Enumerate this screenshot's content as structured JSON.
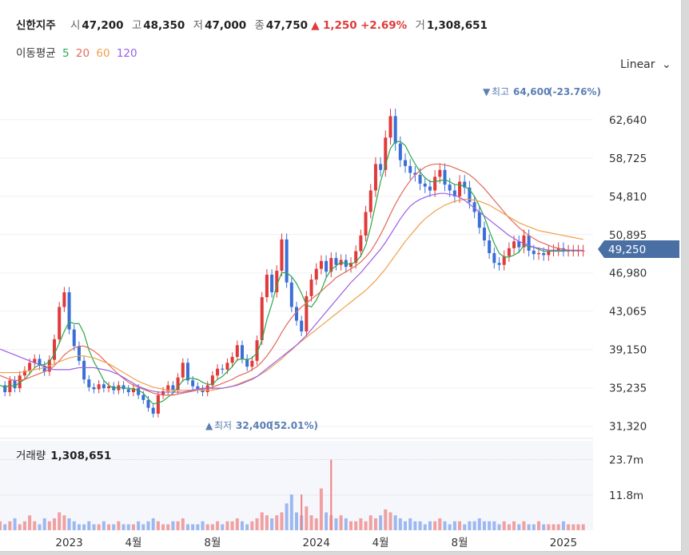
{
  "header": {
    "name": "신한지주",
    "open_label": "시",
    "open": "47,200",
    "high_label": "고",
    "high": "48,350",
    "low_label": "저",
    "low": "47,000",
    "close_label": "종",
    "close": "47,750",
    "change": "1,250",
    "change_pct": "+2.69%",
    "volume_label": "거",
    "volume": "1,308,651"
  },
  "moving_average": {
    "label": "이동평균",
    "periods": [
      {
        "value": "5",
        "color": "#2aa84a"
      },
      {
        "value": "20",
        "color": "#e26a5a"
      },
      {
        "value": "60",
        "color": "#f0a04b"
      },
      {
        "value": "120",
        "color": "#9b5de5"
      }
    ]
  },
  "scale_button": {
    "label": "Linear"
  },
  "current_price": "49,250",
  "volume_panel": {
    "label": "거래량",
    "value": "1,308,651"
  },
  "annotations": {
    "high": {
      "label": "최고",
      "value": "64,600",
      "pct": "(-23.76%)"
    },
    "low": {
      "label": "최저",
      "value": "32,400",
      "pct": "(52.01%)"
    }
  },
  "colors": {
    "up": "#e03a3a",
    "down": "#3a6fd8",
    "price_tag": "#4a6fa5"
  },
  "chart_data": {
    "type": "line",
    "price_axis": {
      "ticks": [
        "62,640",
        "58,725",
        "54,810",
        "50,895",
        "46,980",
        "43,065",
        "39,150",
        "35,235",
        "31,320"
      ],
      "ylim": [
        30400,
        66700
      ]
    },
    "volume_axis": {
      "ticks": [
        "23.7m",
        "11.8m"
      ],
      "ylim": [
        0,
        30
      ]
    },
    "x_ticks": [
      "2023",
      "4월",
      "8월",
      "2024",
      "4월",
      "8월",
      "2025"
    ],
    "x_tick_positions": [
      12,
      25,
      41,
      62,
      75,
      91,
      112
    ],
    "x_range": [
      -2,
      118
    ],
    "series": [
      {
        "name": "price",
        "x": [
          -2,
          -1,
          0,
          1,
          2,
          3,
          4,
          5,
          6,
          7,
          8,
          9,
          10,
          11,
          12,
          13,
          14,
          15,
          16,
          17,
          18,
          19,
          20,
          21,
          22,
          23,
          24,
          25,
          26,
          27,
          28,
          29,
          30,
          31,
          32,
          33,
          34,
          35,
          36,
          37,
          38,
          39,
          40,
          41,
          42,
          43,
          44,
          45,
          46,
          47,
          48,
          49,
          50,
          51,
          52,
          53,
          54,
          55,
          56,
          57,
          58,
          59,
          60,
          61,
          62,
          63,
          64,
          65,
          66,
          67,
          68,
          69,
          70,
          71,
          72,
          73,
          74,
          75,
          76,
          77,
          78,
          79,
          80,
          81,
          82,
          83,
          84,
          85,
          86,
          87,
          88,
          89,
          90,
          91,
          92,
          93,
          94,
          95,
          96,
          97,
          98,
          99,
          100,
          101,
          102,
          103,
          104,
          105,
          106,
          107,
          108,
          109,
          110,
          111,
          112,
          113,
          114,
          115,
          116
        ],
        "values": [
          35500,
          34800,
          36000,
          35200,
          36500,
          37000,
          37800,
          38200,
          37500,
          36900,
          38100,
          40200,
          43500,
          45000,
          41200,
          39500,
          38000,
          36100,
          35300,
          35100,
          35600,
          35200,
          35400,
          35000,
          35500,
          35100,
          34800,
          35200,
          34500,
          34000,
          33200,
          32600,
          34500,
          34900,
          35500,
          35000,
          36300,
          37800,
          36000,
          35400,
          35100,
          34800,
          35500,
          36500,
          37200,
          37100,
          37800,
          38400,
          39600,
          38200,
          37400,
          38000,
          40100,
          44500,
          46800,
          45000,
          47200,
          50400,
          46000,
          43500,
          42100,
          41000,
          44600,
          46300,
          47400,
          48200,
          47100,
          48500,
          47800,
          48300,
          47600,
          48000,
          49200,
          50800,
          53200,
          55400,
          58100,
          57500,
          60800,
          63000,
          60200,
          58500,
          57900,
          57200,
          57000,
          56100,
          55800,
          55400,
          56800,
          57500,
          56000,
          55400,
          54800,
          56300,
          55700,
          54200,
          53200,
          51600,
          50300,
          49000,
          48000,
          47800,
          48700,
          49500,
          50200,
          49600,
          50800,
          49250,
          48900,
          49000,
          48800,
          49250,
          49300,
          49500,
          49250,
          49250,
          49250,
          49250,
          49250
        ],
        "color": "#3a6fd8"
      },
      {
        "name": "5",
        "values": [
          35500,
          35300,
          35500,
          35400,
          35800,
          36100,
          36700,
          37300,
          37600,
          37600,
          37900,
          38700,
          39800,
          41000,
          42000,
          41800,
          41800,
          40800,
          39100,
          37900,
          37000,
          36000,
          35500,
          35200,
          35300,
          35200,
          35200,
          35100,
          35000,
          34700,
          34100,
          33600,
          33700,
          33900,
          34300,
          34700,
          35300,
          36000,
          36200,
          36200,
          36100,
          35800,
          35600,
          35600,
          36100,
          36400,
          36900,
          37400,
          38100,
          38200,
          38100,
          38300,
          38800,
          40100,
          42200,
          43800,
          45700,
          47000,
          47000,
          46600,
          45900,
          44900,
          43700,
          43500,
          44200,
          45200,
          46500,
          47300,
          47700,
          48100,
          47900,
          47900,
          48100,
          48700,
          49800,
          51700,
          54000,
          56300,
          58000,
          59700,
          60400,
          60400,
          60000,
          59000,
          58100,
          57300,
          56700,
          56300,
          56300,
          56400,
          56500,
          56300,
          56000,
          56000,
          55800,
          55500,
          54800,
          53800,
          52700,
          51300,
          50000,
          49000,
          48600,
          48600,
          48800,
          49100,
          49800,
          49700,
          49600,
          49400,
          49200,
          49200,
          49200,
          49200,
          49200,
          49250,
          49250,
          49250,
          49250
        ],
        "color": "#2aa84a"
      },
      {
        "name": "20",
        "values": [
          36500,
          36300,
          36100,
          36000,
          36000,
          36100,
          36300,
          36500,
          36700,
          36900,
          37100,
          37500,
          38000,
          38600,
          39000,
          39300,
          39500,
          39500,
          39300,
          39000,
          38600,
          38100,
          37600,
          37100,
          36600,
          36200,
          35800,
          35500,
          35300,
          35100,
          34900,
          34700,
          34600,
          34500,
          34500,
          34500,
          34600,
          34700,
          34800,
          34900,
          35000,
          35100,
          35200,
          35300,
          35500,
          35700,
          35900,
          36100,
          36400,
          36600,
          36800,
          37100,
          37400,
          37900,
          38500,
          39200,
          40000,
          40900,
          41700,
          42400,
          43000,
          43500,
          43900,
          44300,
          44700,
          45100,
          45600,
          46000,
          46500,
          46800,
          47100,
          47400,
          47700,
          48100,
          48600,
          49200,
          50000,
          50900,
          51900,
          53000,
          54000,
          54900,
          55700,
          56400,
          57000,
          57400,
          57800,
          58000,
          58100,
          58100,
          58000,
          57900,
          57700,
          57500,
          57300,
          57000,
          56600,
          56100,
          55600,
          55000,
          54400,
          53800,
          53200,
          52600,
          52100,
          51600,
          51200,
          50800,
          50500,
          50200,
          50000,
          49800,
          49600,
          49500,
          49400,
          49300,
          49300,
          49250,
          49250
        ],
        "color": "#e26a5a"
      },
      {
        "name": "60",
        "values": [
          36800,
          36800,
          36800,
          36800,
          36800,
          36900,
          37000,
          37100,
          37200,
          37300,
          37500,
          37700,
          37900,
          38100,
          38300,
          38400,
          38500,
          38500,
          38400,
          38300,
          38100,
          37900,
          37700,
          37400,
          37100,
          36800,
          36500,
          36200,
          35900,
          35700,
          35500,
          35300,
          35200,
          35100,
          35000,
          35000,
          35000,
          35000,
          35000,
          35000,
          35000,
          35000,
          35000,
          35000,
          35100,
          35200,
          35300,
          35400,
          35600,
          35800,
          36000,
          36200,
          36400,
          36700,
          37000,
          37400,
          37800,
          38200,
          38700,
          39100,
          39600,
          40000,
          40400,
          40800,
          41200,
          41600,
          42000,
          42400,
          42800,
          43200,
          43600,
          44000,
          44400,
          44800,
          45200,
          45700,
          46200,
          46800,
          47400,
          48100,
          48800,
          49500,
          50200,
          50800,
          51400,
          52000,
          52500,
          52900,
          53300,
          53600,
          53900,
          54100,
          54300,
          54400,
          54500,
          54500,
          54400,
          54300,
          54100,
          53900,
          53600,
          53300,
          53000,
          52700,
          52400,
          52100,
          51900,
          51700,
          51500,
          51300,
          51200,
          51100,
          51000,
          50900,
          50800,
          50700,
          50600,
          50500,
          50400
        ],
        "color": "#f0a04b"
      },
      {
        "name": "120",
        "values": [
          39200,
          39000,
          38800,
          38600,
          38400,
          38200,
          38000,
          37800,
          37600,
          37400,
          37200,
          37100,
          37100,
          37100,
          37100,
          37200,
          37300,
          37300,
          37300,
          37300,
          37200,
          37100,
          37000,
          36800,
          36600,
          36300,
          36000,
          35700,
          35400,
          35200,
          35000,
          34900,
          34800,
          34800,
          34800,
          34800,
          34800,
          34800,
          34900,
          35000,
          35100,
          35200,
          35200,
          35200,
          35200,
          35200,
          35300,
          35400,
          35500,
          35700,
          35900,
          36100,
          36400,
          36800,
          37200,
          37600,
          38000,
          38400,
          38800,
          39200,
          39600,
          40100,
          40600,
          41200,
          41800,
          42400,
          43000,
          43600,
          44200,
          44800,
          45400,
          46000,
          46500,
          47000,
          47600,
          48200,
          48800,
          49400,
          50100,
          50900,
          51700,
          52500,
          53200,
          53800,
          54200,
          54500,
          54700,
          54900,
          55000,
          55100,
          55100,
          55000,
          54900,
          54700,
          54400,
          54000,
          53600,
          53200,
          52800,
          52400,
          52000,
          51600,
          51200,
          50800,
          50500,
          50200,
          50000,
          49800,
          49600,
          49500,
          49400,
          49300,
          49300,
          49300,
          49300,
          49300,
          49300,
          49300,
          49300
        ],
        "color": "#9b5de5"
      }
    ],
    "volume_series": {
      "name": "거래량",
      "note": "",
      "values": [
        3,
        2,
        3,
        4,
        2,
        3,
        5,
        3,
        2,
        4,
        3,
        4,
        6,
        5,
        4,
        3,
        2,
        2,
        3,
        2,
        2,
        3,
        2,
        2,
        3,
        2,
        2,
        2,
        3,
        2,
        3,
        4,
        3,
        2,
        2,
        3,
        3,
        4,
        2,
        2,
        2,
        3,
        2,
        2,
        3,
        2,
        3,
        3,
        4,
        3,
        2,
        3,
        4,
        6,
        5,
        4,
        5,
        6,
        9,
        12,
        6,
        5,
        8,
        5,
        4,
        14,
        6,
        5,
        4,
        5,
        4,
        3,
        3,
        4,
        3,
        5,
        4,
        5,
        7,
        6,
        5,
        4,
        3,
        4,
        3,
        3,
        2,
        3,
        3,
        4,
        3,
        2,
        3,
        3,
        2,
        3,
        3,
        4,
        3,
        3,
        3,
        2,
        3,
        2,
        3,
        2,
        3,
        2,
        2,
        3,
        2,
        2,
        2,
        2,
        3,
        2,
        2,
        2,
        2
      ],
      "spikes": [
        {
          "x": 59,
          "value": 12
        },
        {
          "x": 65,
          "value": 23.7
        }
      ]
    }
  }
}
